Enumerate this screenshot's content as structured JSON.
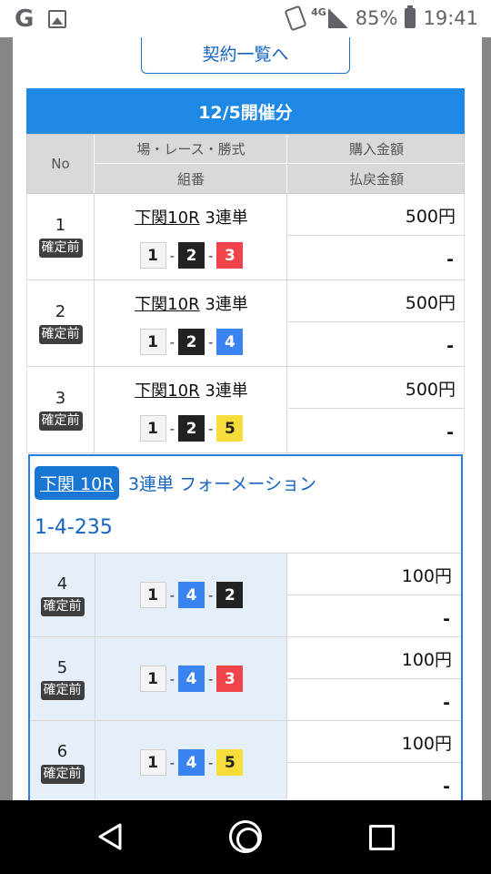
{
  "status_bar": {
    "network": "4G",
    "battery": "85%",
    "time": "19:41"
  },
  "contract_list_link": "契約一覧へ",
  "day_header": "12/5開催分",
  "table_header": {
    "no": "No",
    "race": "場・レース・勝式",
    "purchase": "購入金額",
    "combination": "組番",
    "payout": "払戻金額"
  },
  "rows": [
    {
      "no": "1",
      "status": "確定前",
      "venue_race": "下関10R",
      "bet_type": "3連単",
      "combo": [
        "1",
        "2",
        "3"
      ],
      "amount": "500円",
      "payout": "-"
    },
    {
      "no": "2",
      "status": "確定前",
      "venue_race": "下関10R",
      "bet_type": "3連単",
      "combo": [
        "1",
        "2",
        "4"
      ],
      "amount": "500円",
      "payout": "-"
    },
    {
      "no": "3",
      "status": "確定前",
      "venue_race": "下関10R",
      "bet_type": "3連単",
      "combo": [
        "1",
        "2",
        "5"
      ],
      "amount": "500円",
      "payout": "-"
    }
  ],
  "formation": {
    "venue_race": "下関 10R",
    "type": "3連単 フォーメーション",
    "combo": "1-4-235",
    "rows": [
      {
        "no": "4",
        "status": "確定前",
        "combo": [
          "1",
          "4",
          "2"
        ],
        "amount": "100円",
        "payout": "-"
      },
      {
        "no": "5",
        "status": "確定前",
        "combo": [
          "1",
          "4",
          "3"
        ],
        "amount": "100円",
        "payout": "-"
      },
      {
        "no": "6",
        "status": "確定前",
        "combo": [
          "1",
          "4",
          "5"
        ],
        "amount": "100円",
        "payout": "-"
      }
    ]
  },
  "colors": {
    "header_blue": "#1e88e5",
    "boat_1": "#f4f4f4",
    "boat_2": "#222222",
    "boat_3": "#f0434a",
    "boat_4": "#3b83f0",
    "boat_5": "#f7dd3a"
  },
  "icons": [
    "google-icon",
    "image-icon",
    "wifi-calling-icon",
    "signal-icon",
    "battery-charging-icon",
    "back-icon",
    "home-icon",
    "recents-icon"
  ]
}
